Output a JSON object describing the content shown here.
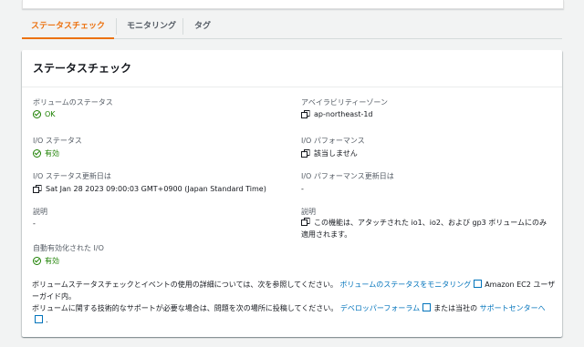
{
  "tabs": [
    {
      "label": "ステータスチェック",
      "active": true
    },
    {
      "label": "モニタリング",
      "active": false
    },
    {
      "label": "タグ",
      "active": false
    }
  ],
  "panel": {
    "title": "ステータスチェック",
    "left": {
      "volume_status_label": "ボリュームのステータス",
      "volume_status_value": "OK",
      "io_status_label": "I/O ステータス",
      "io_status_value": "有効",
      "io_updated_label": "I/O ステータス更新日は",
      "io_updated_value": "Sat Jan 28 2023 09:00:03 GMT+0900 (Japan Standard Time)",
      "description_label": "説明",
      "description_value": "-",
      "auto_io_label": "自動有効化された I/O",
      "auto_io_value": "有効"
    },
    "right": {
      "az_label": "アベイラビリティーゾーン",
      "az_value": "ap-northeast-1d",
      "io_perf_label": "I/O パフォーマンス",
      "io_perf_value": "該当しません",
      "io_perf_updated_label": "I/O パフォーマンス更新日は",
      "io_perf_updated_value": "-",
      "description_label": "説明",
      "description_line1": "この機能は、アタッチされた io1、io2、および gp3 ボリュームにのみ",
      "description_line2": "適用されます。"
    },
    "footer": {
      "p1_text": "ボリュームステータスチェックとイベントの使用の詳細については、次を参照してください。",
      "p1_link": "ボリュームのステータスをモニタリング",
      "p1_after": "Amazon EC2 ユーザーガイド内。",
      "p2_text": "ボリュームに関する技術的なサポートが必要な場合は、問題を次の場所に投稿してください。",
      "p2_link1": "デベロッパーフォーラム",
      "p2_mid": "または当社の",
      "p2_link2": "サポートセンターへ",
      "p2_end": "."
    }
  },
  "colors": {
    "accent": "#ec7211",
    "ok": "#1d8102",
    "link": "#0073bb"
  }
}
